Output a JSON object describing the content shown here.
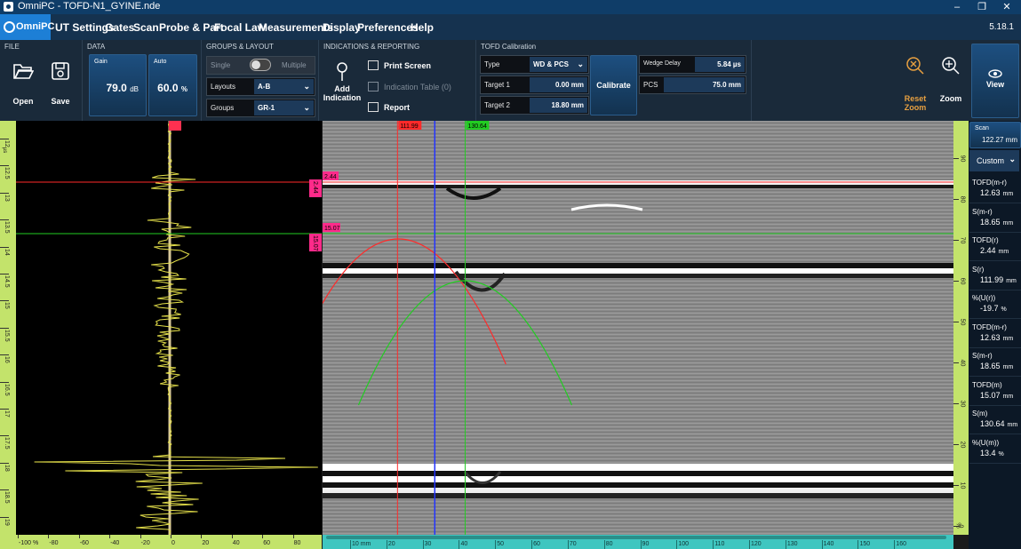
{
  "window": {
    "title": "OmniPC - TOFD-N1_GYINE.nde"
  },
  "menu": {
    "brand": "OmniPC",
    "items": [
      "UT Settings",
      "Gates",
      "Scan",
      "Probe & Part",
      "Focal Law",
      "Measurements",
      "Display",
      "Preferences",
      "Help"
    ],
    "version": "5.18.1"
  },
  "ribbon": {
    "file": {
      "caption": "FILE",
      "open": "Open",
      "save": "Save"
    },
    "data": {
      "caption": "DATA",
      "gain_label": "Gain",
      "gain_value": "79.0",
      "gain_unit": "dB",
      "auto_label": "Auto",
      "auto_value": "60.0",
      "auto_unit": "%"
    },
    "groups": {
      "caption": "GROUPS & LAYOUT",
      "single": "Single",
      "multiple": "Multiple",
      "layouts_label": "Layouts",
      "layouts_value": "A-B",
      "groups_label": "Groups",
      "groups_value": "GR-1"
    },
    "indications": {
      "caption": "INDICATIONS & REPORTING",
      "add": "Add",
      "indication": "Indication",
      "print": "Print Screen",
      "table": "Indication Table (0)",
      "report": "Report"
    },
    "tofd": {
      "caption": "TOFD Calibration",
      "type_label": "Type",
      "type_value": "WD & PCS",
      "t1_label": "Target 1",
      "t1_value": "0.00 mm",
      "t2_label": "Target 2",
      "t2_value": "18.80 mm",
      "calibrate": "Calibrate",
      "wd_label": "Wedge Delay",
      "wd_value": "5.84 µs",
      "pcs_label": "PCS",
      "pcs_value": "75.0 mm"
    },
    "view": {
      "reset1": "Reset",
      "reset2": "Zoom",
      "zoom": "Zoom",
      "view": "View"
    }
  },
  "scan": {
    "label": "Scan",
    "value": "122.27 mm",
    "mode": "Custom"
  },
  "measurements": [
    {
      "label": "TOFD(m-r)",
      "value": "12.63",
      "unit": "mm"
    },
    {
      "label": "S(m-r)",
      "value": "18.65",
      "unit": "mm"
    },
    {
      "label": "TOFD(r)",
      "value": "2.44",
      "unit": "mm"
    },
    {
      "label": "S(r)",
      "value": "111.99",
      "unit": "mm"
    },
    {
      "label": "%(U(r))",
      "value": "-19.7",
      "unit": "%"
    },
    {
      "label": "TOFD(m-r)",
      "value": "12.63",
      "unit": "mm"
    },
    {
      "label": "S(m-r)",
      "value": "18.65",
      "unit": "mm"
    },
    {
      "label": "TOFD(m)",
      "value": "15.07",
      "unit": "mm"
    },
    {
      "label": "S(m)",
      "value": "130.64",
      "unit": "mm"
    },
    {
      "label": "%(U(m))",
      "value": "13.4",
      "unit": "%"
    }
  ],
  "cursors": {
    "ref_depth": "2.44",
    "meas_depth": "15.07",
    "ref_scan": "111.99",
    "meas_scan": "130.64",
    "a_ref": "2.44",
    "a_meas": "15.07"
  },
  "left_axis_ticks": [
    "12",
    "12.5",
    "13",
    "13.5",
    "14",
    "14.5",
    "15",
    "15.5",
    "16",
    "16.5",
    "17",
    "17.5",
    "18",
    "18.5",
    "19"
  ],
  "left_axis_unit": "µs",
  "right_axis_ticks": [
    "90",
    "80",
    "70",
    "60",
    "50",
    "40",
    "30",
    "20",
    "10",
    "0"
  ],
  "right_axis_unit": "%",
  "amp_ticks": [
    "-100 %",
    "-80",
    "-60",
    "-40",
    "-20",
    "0",
    "20",
    "40",
    "60",
    "80"
  ],
  "scan_ticks": [
    "10",
    "20",
    "30",
    "40",
    "50",
    "60",
    "70",
    "80",
    "90",
    "100",
    "110",
    "120",
    "130",
    "140",
    "150",
    "160"
  ],
  "scan_unit": "mm",
  "colors": {
    "reference": "#ff2a2a",
    "measure": "#22cc22",
    "scan_cursor": "#2233ff",
    "ascan": "#e6e14a"
  }
}
